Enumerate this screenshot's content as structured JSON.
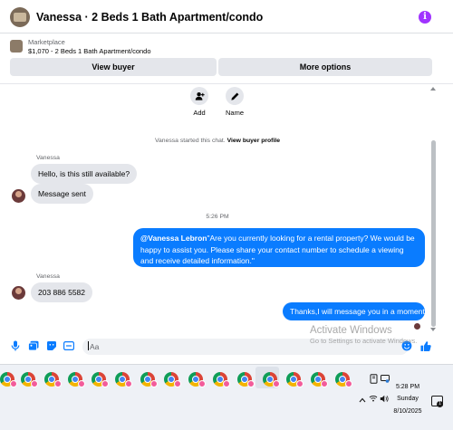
{
  "header": {
    "title": "Vanessa · 2 Beds 1 Bath Apartment/condo",
    "info_icon": "info-icon",
    "info_glyph": "i",
    "accent": "#a033ff"
  },
  "listing": {
    "label": "Marketplace",
    "item": "$1,070 - 2 Beds 1 Bath Apartment/condo",
    "view_buyer": "View buyer",
    "more_options": "More options"
  },
  "actions": [
    {
      "label": "Add",
      "icon": "add-person-icon"
    },
    {
      "label": "Name",
      "icon": "pencil-icon"
    }
  ],
  "system_note": {
    "text": "Vanessa started this chat.",
    "link": "View buyer profile"
  },
  "messages": {
    "sender": "Vanessa",
    "first": "Hello, is this still available?",
    "second": "Message sent",
    "time": "5:26 PM",
    "out_mention": "@Vanessa Lebron",
    "out_long": "\"Are you currently looking for a rental property? We would be happy to assist you. Please share your contact number to schedule a viewing and receive detailed information.\"",
    "sender2": "Vanessa",
    "phone": "203 886 5582",
    "out_short": "Thanks,I will message you in a moment."
  },
  "composer": {
    "placeholder": "Aa",
    "icons": [
      "microphone-icon",
      "photo-icon",
      "sticker-icon",
      "gif-icon"
    ],
    "emoji_icon": "emoji-icon",
    "like_icon": "thumbs-up-icon"
  },
  "watermark": {
    "title": "Activate Windows",
    "subtitle": "Go to Settings to activate Windows."
  },
  "taskbar": {
    "time": "5:28 PM",
    "day": "Sunday",
    "date": "8/10/2025",
    "notification_count": "1",
    "app_icon": "chrome-icon",
    "brand_color": "#0a7cff"
  }
}
